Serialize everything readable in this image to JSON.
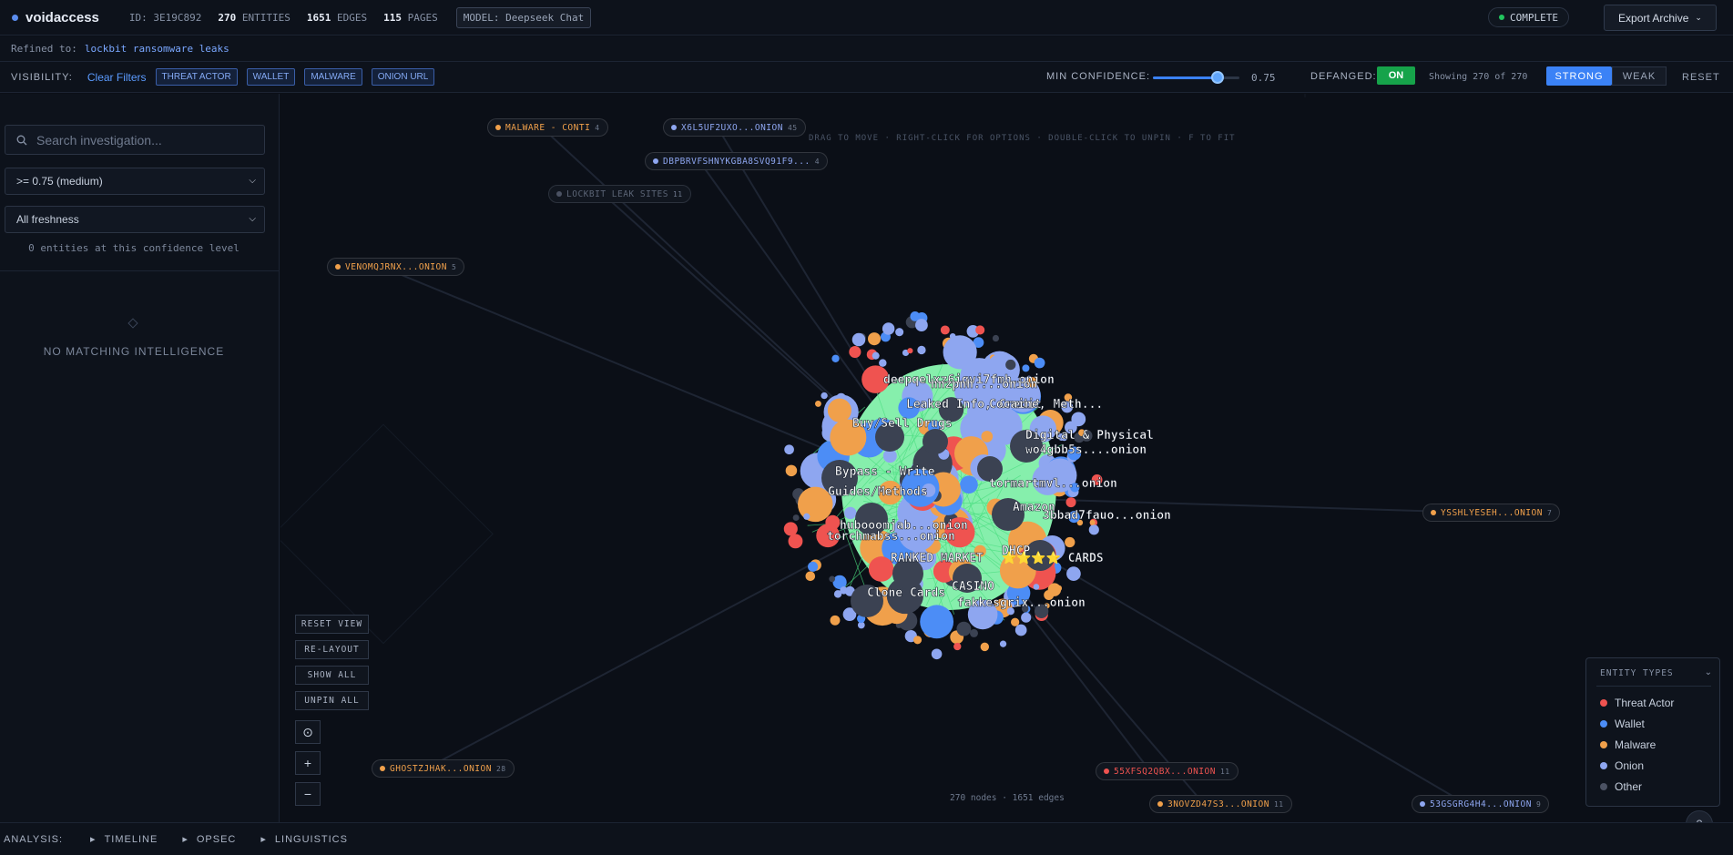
{
  "app": {
    "name": "voidaccess",
    "id_label": "ID:",
    "id": "3E19C892",
    "entities_count": "270",
    "entities_label": "ENTITIES",
    "edges_count": "1651",
    "edges_label": "EDGES",
    "pages_count": "115",
    "pages_label": "PAGES",
    "model_label": "MODEL:",
    "model": "Deepseek Chat",
    "status": "COMPLETE",
    "export": "Export Archive",
    "colors": {
      "accent": "#3b82f6",
      "green": "#22c55e"
    }
  },
  "refined": {
    "label": "Refined to:",
    "query": "lockbit ransomware leaks"
  },
  "visibility": {
    "label": "VISIBILITY:",
    "clear": "Clear Filters",
    "chips": [
      "THREAT ACTOR",
      "WALLET",
      "MALWARE",
      "ONION URL"
    ],
    "min_conf_label": "MIN CONFIDENCE:",
    "min_conf_value": "0.75",
    "min_conf_fraction": 0.75,
    "defanged_label": "DEFANGED:",
    "defanged_state": "ON",
    "showing": "Showing 270 of 270",
    "strong": "STRONG",
    "weak": "WEAK",
    "reset": "RESET"
  },
  "sidebar": {
    "search_placeholder": "Search investigation...",
    "confidence_select": ">= 0.75 (medium)",
    "freshness_select": "All freshness",
    "entity_count_text": "0 entities at this confidence level",
    "empty_text": "NO MATCHING INTELLIGENCE"
  },
  "graph": {
    "hint": "DRAG TO MOVE · RIGHT-CLICK FOR OPTIONS · DOUBLE-CLICK TO UNPIN · F TO FIT",
    "pills": [
      {
        "label": "MALWARE - CONTI",
        "count": "4",
        "type": "malware"
      },
      {
        "label": "X6L5UF2UXO...ONION",
        "count": "45",
        "type": "onion"
      },
      {
        "label": "DBPBRVFSHNYKGBA8SVQ91F9...",
        "count": "4",
        "type": "onion"
      },
      {
        "label": "LOCKBIT LEAK SITES",
        "count": "11",
        "type": "other"
      },
      {
        "label": "VENOMQJRNX...ONION",
        "count": "5",
        "type": "malware"
      },
      {
        "label": "YSSHLYESEH...ONION",
        "count": "7",
        "type": "malware"
      },
      {
        "label": "GHOSTZJHAK...ONION",
        "count": "28",
        "type": "malware"
      },
      {
        "label": "55XFSQ2QBX...ONION",
        "count": "11",
        "type": "threat"
      },
      {
        "label": "3NOVZD47S3...ONION",
        "count": "11",
        "type": "malware"
      },
      {
        "label": "53GSGRG4H4...ONION",
        "count": "9",
        "type": "onion"
      }
    ],
    "cluster_labels": [
      "deepqelxz6iqvi7fmh.onion",
      "hnzpnh....onion",
      "Leaked Info, Credit",
      "Cocaine, Meth...",
      "Buy/Sell Drugs",
      "Digital & Physical",
      "wo4gbb5s....onion",
      "Bypass - Write",
      "Guides/Methods",
      "tormartmvl...onion",
      "Amazon",
      "3bbad7fauo...onion",
      "hubooomjab...onion",
      "torchmabss...onion",
      "RANKED MARKET",
      "DHCP",
      "⭐⭐⭐⭐ CARDS",
      "CASINO",
      "Clone Cards",
      "fakkesgrix...onion"
    ],
    "controls": [
      "RESET VIEW",
      "RE-LAYOUT",
      "SHOW ALL",
      "UNPIN ALL"
    ],
    "footer": "270 nodes · 1651 edges"
  },
  "legend": {
    "title": "ENTITY TYPES",
    "items": [
      {
        "label": "Threat Actor",
        "color": "#ef5350"
      },
      {
        "label": "Wallet",
        "color": "#4c8df6"
      },
      {
        "label": "Malware",
        "color": "#f0a04b"
      },
      {
        "label": "Onion",
        "color": "#8ea6f0"
      },
      {
        "label": "Other",
        "color": "#4b5263"
      }
    ]
  },
  "analysis": {
    "label": "ANALYSIS:",
    "tabs": [
      "TIMELINE",
      "OPSEC",
      "LINGUISTICS"
    ]
  }
}
